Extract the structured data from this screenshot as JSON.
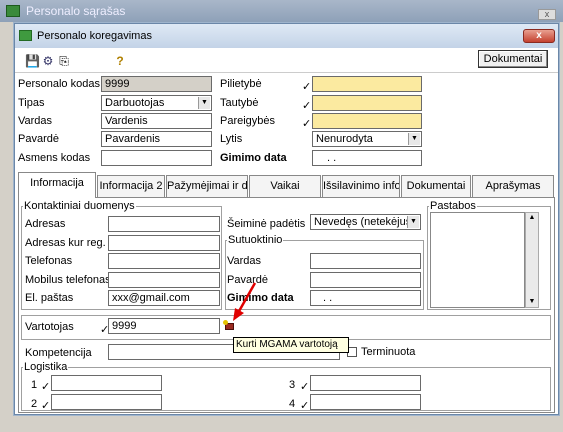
{
  "bg_window": {
    "title": "Personalo sąrašas"
  },
  "dialog": {
    "title": "Personalo koregavimas",
    "close": "x",
    "dokumentai": "Dokumentai"
  },
  "toolbar": {
    "save": "💾",
    "filter": "⚙",
    "copy": "⎘",
    "help": "?"
  },
  "person": {
    "kodas_label": "Personalo kodas",
    "kodas_value": "9999",
    "tipas_label": "Tipas",
    "tipas_value": "Darbuotojas",
    "vardas_label": "Vardas",
    "vardas_value": "Vardenis",
    "pavarde_label": "Pavardė",
    "pavarde_value": "Pavardenis",
    "asmens_label": "Asmens kodas",
    "asmens_value": "",
    "pilietybe_label": "Pilietybė",
    "tautybe_label": "Tautybė",
    "pareigybes_label": "Pareigybės",
    "lytis_label": "Lytis",
    "lytis_value": "Nenurodyta",
    "gimimo_label": "Gimimo data",
    "gimimo_value": ". ."
  },
  "tabs": [
    "Informacija",
    "Informacija 2",
    "Pažymėjimai ir d",
    "Vaikai",
    "Išsilavinimo info",
    "Dokumentai",
    "Aprašymas"
  ],
  "info": {
    "kontaktiniai_title": "Kontaktiniai duomenys",
    "adresas_label": "Adresas",
    "adresas_kur_label": "Adresas kur reg.",
    "telefonas_label": "Telefonas",
    "mobilus_label": "Mobilus telefonas",
    "el_pastas_label": "El. paštas",
    "el_pastas_value": "xxx@gmail.com",
    "seimine_label": "Šeiminė padėtis",
    "seimine_value": "Nevedęs (netekėjusi)",
    "sutuoktinio_title": "Sutuoktinio",
    "s_vardas_label": "Vardas",
    "s_pavarde_label": "Pavardė",
    "s_gimimo_label": "Gimimo data",
    "s_gimimo_value": ". .",
    "pastabos_title": "Pastabos",
    "vartotojas_label": "Vartotojas",
    "vartotojas_value": "9999",
    "tooltip": "Kurti MGAMA vartotoją",
    "kompetencija_label": "Kompetencija",
    "terminuota_label": "Terminuota",
    "logistika_title": "Logistika",
    "log1": "1",
    "log2": "2",
    "log3": "3",
    "log4": "4"
  },
  "check": "✓"
}
